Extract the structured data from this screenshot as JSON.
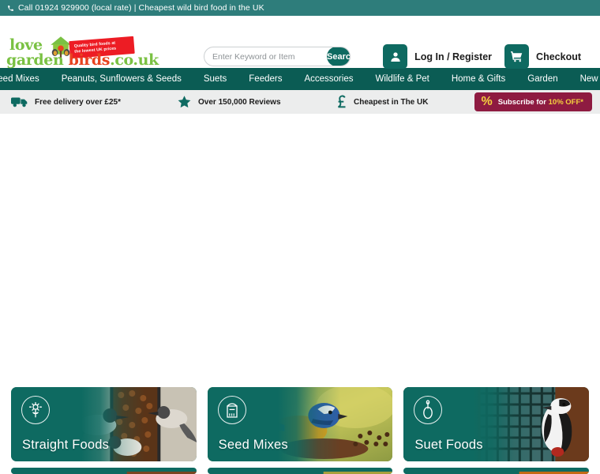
{
  "topbar": {
    "icon": "phone-icon",
    "text": "Call 01924 929900 (local rate)  |  Cheapest wild bird food in the UK"
  },
  "header": {
    "logo": {
      "line1": "love",
      "garden": "garden ",
      "birds": "birds",
      "tld": ".co.uk",
      "badge_line1": "Quality bird foods at",
      "badge_line2": "the lowest UK prices",
      "graphic": "birdhouse-icon"
    },
    "search": {
      "placeholder": "Enter Keyword or Item",
      "value": "",
      "button_label": "Search"
    },
    "account": {
      "login_label": "Log In / Register",
      "login_icon": "user-icon",
      "checkout_label": "Checkout",
      "checkout_icon": "cart-icon"
    }
  },
  "nav": {
    "items": [
      {
        "label": "Seed Mixes"
      },
      {
        "label": "Peanuts, Sunflowers & Seeds"
      },
      {
        "label": "Suets"
      },
      {
        "label": "Feeders"
      },
      {
        "label": "Accessories"
      },
      {
        "label": "Wildlife & Pet"
      },
      {
        "label": "Home & Gifts"
      },
      {
        "label": "Garden"
      },
      {
        "label": "New In"
      }
    ]
  },
  "usp": {
    "items": [
      {
        "icon": "delivery-truck-icon",
        "text": "Free delivery over £25*"
      },
      {
        "icon": "star-icon",
        "text": "Over 150,000 Reviews"
      },
      {
        "icon": "pound-sterling-icon",
        "text": "Cheapest in The UK"
      }
    ],
    "promo": {
      "icon": "percent-icon",
      "text_before": "Subscribe for ",
      "text_highlight": "10% OFF*"
    }
  },
  "categories": [
    {
      "title": "Straight Foods",
      "icon": "sunflower-icon"
    },
    {
      "title": "Seed Mixes",
      "icon": "seed-bag-icon"
    },
    {
      "title": "Suet Foods",
      "icon": "suet-spoon-icon"
    }
  ],
  "colors": {
    "topbar_teal": "#2e7d7b",
    "nav_teal": "#0b5c54",
    "brand_teal": "#0e6a61",
    "logo_green": "#7ac143",
    "logo_red": "#e8431f",
    "badge_red": "#ed1c24",
    "promo_maroon": "#8e1b41",
    "promo_yellow": "#f4d03f",
    "usp_grey": "#eceded"
  }
}
